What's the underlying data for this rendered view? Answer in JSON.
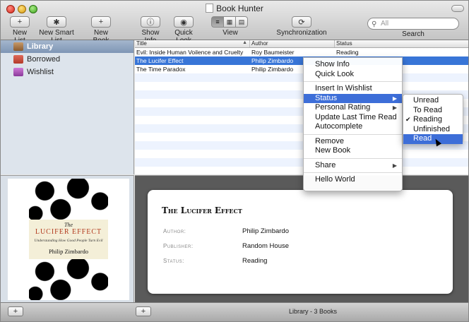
{
  "window": {
    "title": "Book Hunter"
  },
  "toolbar": {
    "new_list": "New List",
    "new_smart_list": "New Smart List",
    "new_book": "New Book",
    "show_info": "Show Info",
    "quick_look": "Quick Look",
    "view": "View",
    "synchronization": "Synchronization",
    "search_placeholder": "All",
    "search_label": "Search"
  },
  "sidebar": {
    "items": [
      {
        "label": "Library",
        "icon": "library-icon",
        "selected": true
      },
      {
        "label": "Borrowed",
        "icon": "borrowed-icon",
        "selected": false
      },
      {
        "label": "Wishlist",
        "icon": "wishlist-icon",
        "selected": false
      }
    ]
  },
  "list": {
    "columns": [
      "Title",
      "Author",
      "Status"
    ],
    "rows": [
      {
        "title": "Evil: Inside Human Voilence and Cruelty",
        "author": "Roy Baumeister",
        "status": "Reading"
      },
      {
        "title": "The Lucifer Effect",
        "author": "Philip Zimbardo",
        "status": ""
      },
      {
        "title": "The Time Paradox",
        "author": "Philip Zimbardo",
        "status": ""
      }
    ]
  },
  "cover": {
    "the": "The",
    "title": "LUCIFER EFFECT",
    "subtitle": "Understanding How Good People Turn Evil",
    "author": "Philip Zimbardo"
  },
  "detail": {
    "title": "The Lucifer Effect",
    "author_label": "Author:",
    "author": "Philip Zimbardo",
    "publisher_label": "Publisher:",
    "publisher": "Random House",
    "status_label": "Status:",
    "status": "Reading"
  },
  "context_menu": {
    "show_info": "Show Info",
    "quick_look": "Quick Look",
    "insert_in_wishlist": "Insert In Wishlist",
    "status": "Status",
    "personal_rating": "Personal Rating",
    "update_last_time_read": "Update Last Time Read",
    "autocomplete": "Autocomplete",
    "remove": "Remove",
    "new_book": "New Book",
    "share": "Share",
    "hello_world": "Hello World"
  },
  "status_submenu": {
    "unread": "Unread",
    "to_read": "To Read",
    "reading": "Reading",
    "unfinished": "Unfinished",
    "read": "Read"
  },
  "footer": {
    "status": "Library - 3 Books",
    "add": "+"
  },
  "colors": {
    "selection": "#3875d7",
    "menu_highlight": "#3d6ed8",
    "sidebar_bg": "#dde4ec",
    "detail_bg": "#5a5a5a"
  }
}
